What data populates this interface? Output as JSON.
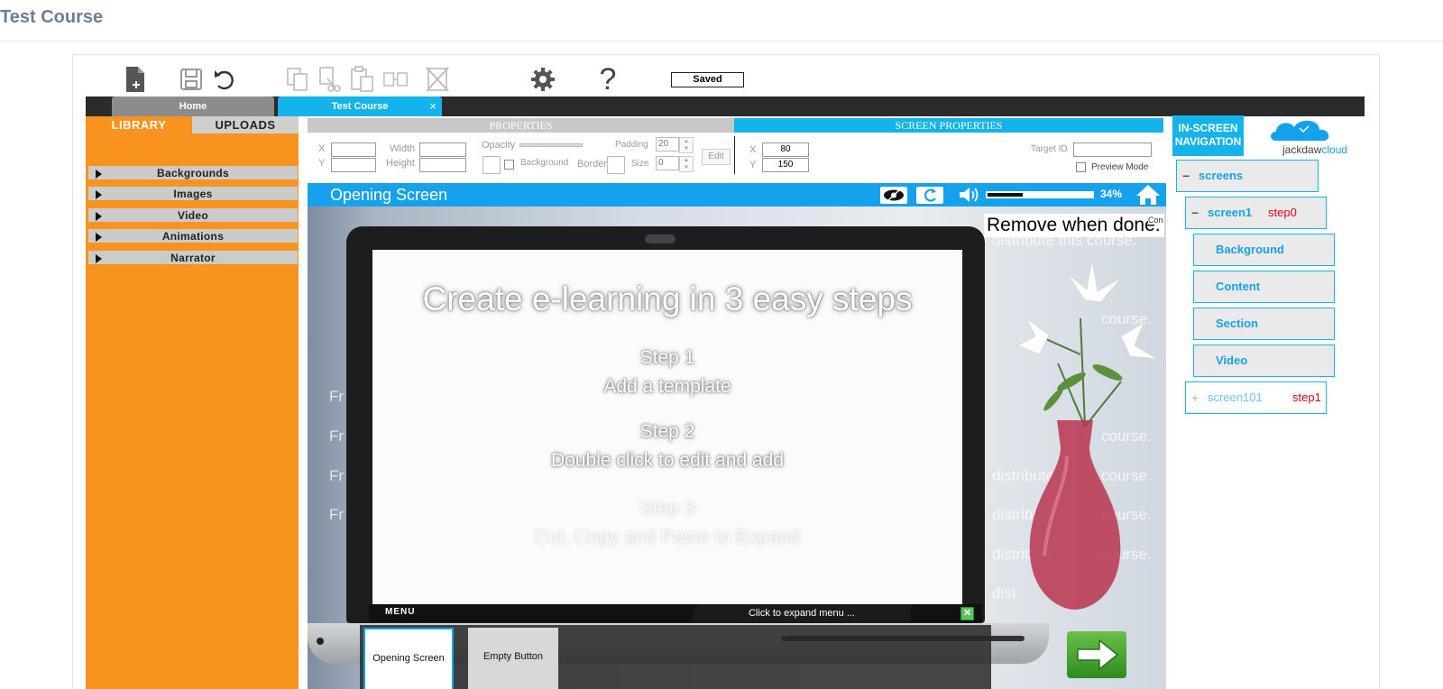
{
  "page": {
    "title": "Test Course"
  },
  "toolbar": {
    "saved_label": "Saved",
    "icons": [
      "new-page-icon",
      "save-icon",
      "undo-icon",
      "copy-icon",
      "cut-icon",
      "paste-icon",
      "duplicate-icon",
      "delete-icon",
      "settings-icon",
      "help-icon"
    ]
  },
  "tabs": {
    "home": "Home",
    "course": "Test Course",
    "close_glyph": "×"
  },
  "library": {
    "tab_library": "LIBRARY",
    "tab_uploads": "UPLOADS",
    "items": [
      "Backgrounds",
      "Images",
      "Video",
      "Animations",
      "Narrator"
    ]
  },
  "properties": {
    "header": "PROPERTIES",
    "screen_header": "SCREEN PROPERTIES",
    "x_label": "X",
    "y_label": "Y",
    "width_label": "Width",
    "height_label": "Height",
    "opacity_label": "Opacity",
    "padding_label": "Padding",
    "padding_value": "20",
    "background_label": "Background",
    "border_label": "Border",
    "size_label": "Size",
    "size_value": "0",
    "edit_label": "Edit",
    "screen_x_value": "80",
    "screen_y_value": "150",
    "target_id_label": "Target ID",
    "preview_mode_label": "Preview Mode"
  },
  "stage": {
    "title": "Opening Screen",
    "volume_percent": "34%",
    "volume_level": 0.34,
    "remove_note": "Remove when done.",
    "con_note": "Con",
    "bg_lines_left": [
      "Fr",
      "Fr",
      "Fr",
      "Fr"
    ],
    "bg_lines_right": [
      "distribute this course.",
      "course.",
      "course.",
      "distribute",
      "course.",
      "distribute",
      "course.",
      "distribute",
      "course.",
      "distrib",
      "se.",
      "dist"
    ],
    "screen_title": "Create e-learning in 3 easy steps",
    "step1_heading": "Step 1",
    "step1_text": "Add a template",
    "step2_heading": "Step 2",
    "step2_text": "Double click to edit and add",
    "step3_heading": "Step 3",
    "step3_text": "Cut, Copy and Paste to Expand",
    "menu_label": "MENU",
    "expand_menu_text": "Click to expand menu ...",
    "thumbnails": [
      "Opening Screen",
      "Empty Button"
    ]
  },
  "navigation": {
    "header": "IN-SCREEN NAVIGATION",
    "logo_part1": "jackdaw",
    "logo_part2": "cloud",
    "nodes": {
      "screens": "screens",
      "screen1": "screen1",
      "screen1_step": "step0",
      "background": "Background",
      "content": "Content",
      "section": "Section",
      "video": "Video",
      "screen101": "screen101",
      "screen101_step": "step1"
    },
    "expanded_sign": "−",
    "collapsed_sign": "+"
  },
  "colors": {
    "accent_blue": "#15b3ec",
    "library_orange": "#f7931e",
    "step_red": "#e0001b",
    "title_gray": "#6d7f94"
  }
}
